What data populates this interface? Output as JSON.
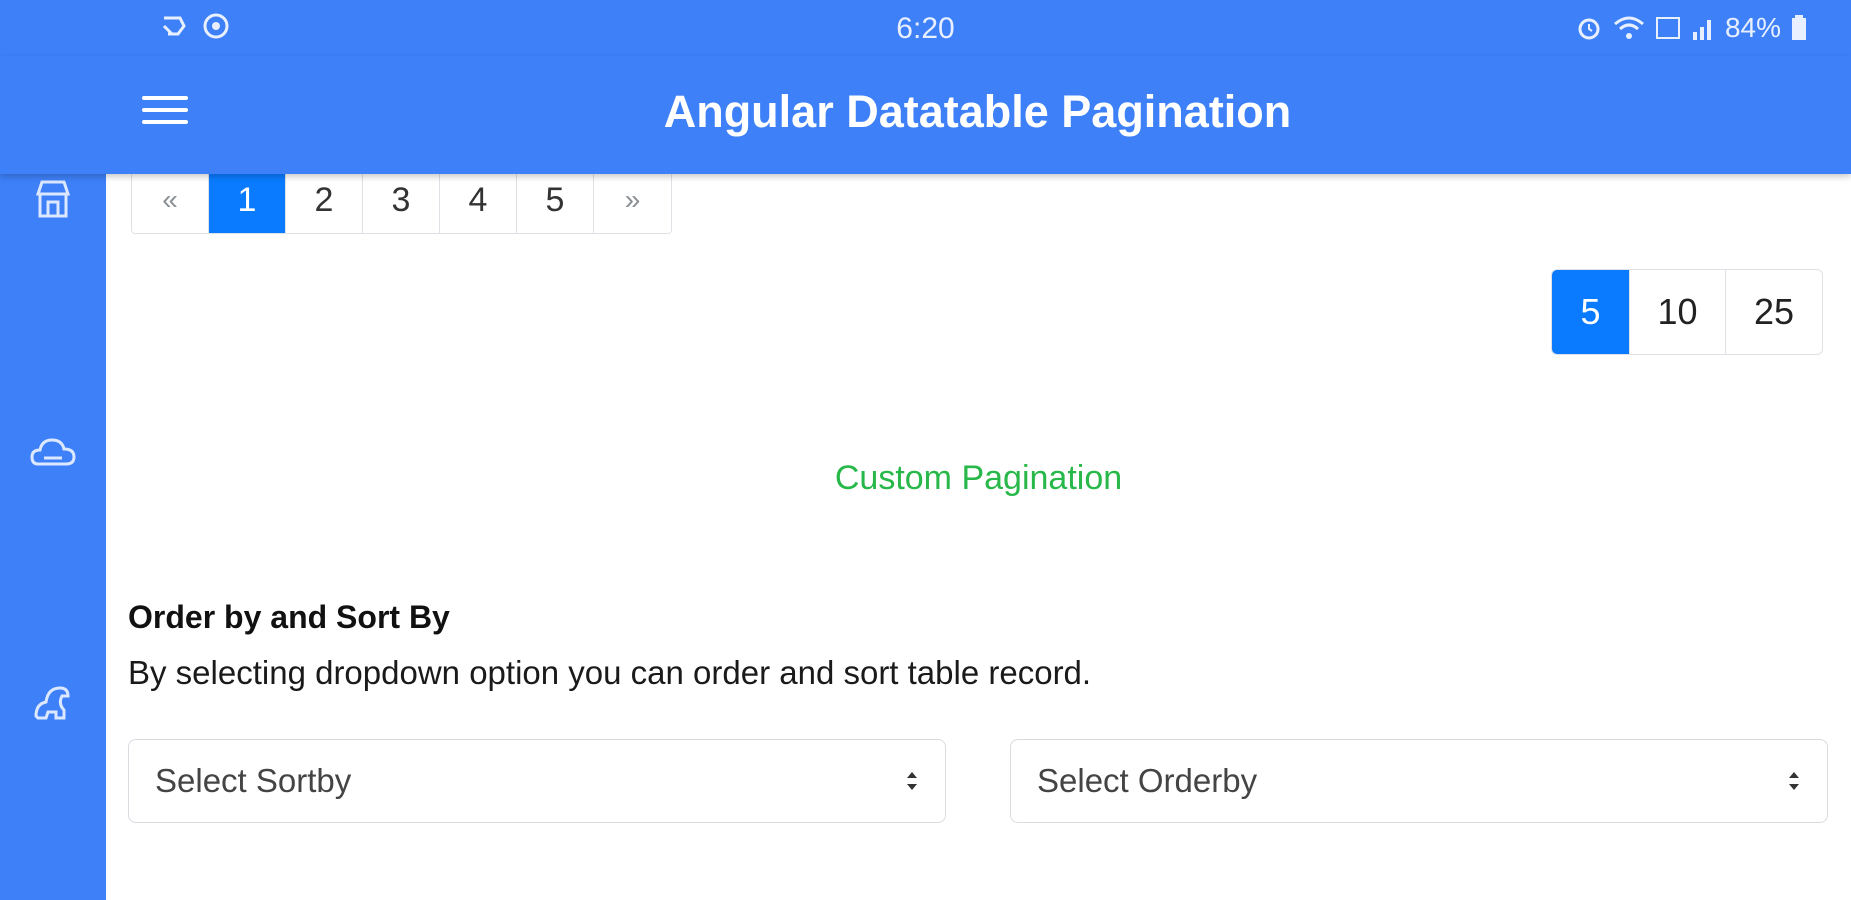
{
  "status_bar": {
    "time": "6:20",
    "battery": "84%",
    "left_icons": [
      "cast-icon",
      "app-notification-icon"
    ],
    "right_icons": [
      "alarm-icon",
      "wifi-icon",
      "volte-icon",
      "signal-icon",
      "battery-icon"
    ]
  },
  "app_bar": {
    "title": "Angular Datatable Pagination",
    "menu_icon": "hamburger-menu-icon",
    "color": "#3d80f8"
  },
  "sidebar": {
    "icons": [
      "store-icon",
      "cloud-icon",
      "dinosaur-icon"
    ]
  },
  "pagination": {
    "prev": "«",
    "pages": [
      "1",
      "2",
      "3",
      "4",
      "5"
    ],
    "next": "»",
    "active_page": "1",
    "active_color": "#0a7bff"
  },
  "page_size": {
    "options": [
      "5",
      "10",
      "25"
    ],
    "active": "5"
  },
  "custom_pagination_label": "Custom Pagination",
  "order_section": {
    "title": "Order by and Sort By",
    "description": "By selecting dropdown option you can order and sort table record.",
    "sort_select": "Select Sortby",
    "order_select": "Select Orderby"
  }
}
